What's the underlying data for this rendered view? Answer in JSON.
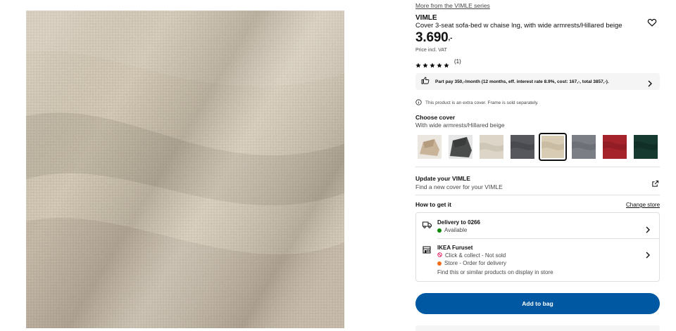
{
  "product": {
    "series_link": "More from the VIMLE series",
    "brand": "VIMLE",
    "description": "Cover 3-seat sofa-bed w chaise lng, with wide armrests/Hillared beige",
    "price_main": "3.690",
    "price_decimal": ",-",
    "vat_note": "Price incl. VAT",
    "rating_count": "(1)",
    "rating_value": 5,
    "favourite_icon": "heart-outline-icon",
    "image_alt": "Hillared beige fabric"
  },
  "finance": {
    "text": "Part pay 350,-/month (12 months, eff. interest rate 8.9%, cost: 167,-, total 3857,-).",
    "icon": "thumbs-up-icon"
  },
  "info": {
    "text": "This product is an extra cover. Frame is sold separately.",
    "icon": "info-icon"
  },
  "cover": {
    "title": "Choose cover",
    "selected": "With wide armrests/Hillared beige",
    "swatches": [
      {
        "name": "beige-natural",
        "color": "#c9b49a"
      },
      {
        "name": "dark-grey",
        "color": "#4a4c4c"
      },
      {
        "name": "light-beige",
        "color": "#ddd6c8"
      },
      {
        "name": "anthracite",
        "color": "#55575c"
      },
      {
        "name": "hillared-beige",
        "color": "#d8ccb4",
        "selected": true
      },
      {
        "name": "grey",
        "color": "#7b7e84"
      },
      {
        "name": "dark-red",
        "color": "#a5232b"
      },
      {
        "name": "dark-green",
        "color": "#163a30"
      }
    ]
  },
  "update": {
    "title": "Update your VIMLE",
    "subtitle": "Find a new cover for your VIMLE",
    "icon": "external-link-icon"
  },
  "delivery": {
    "heading": "How to get it",
    "change_store": "Change store",
    "delivery_title": "Delivery to 0266",
    "delivery_status": "Available",
    "delivery_status_color": "#0a8a00",
    "store_title": "IKEA Furuset",
    "click_collect": "Click & collect - Not sold",
    "click_collect_color": "#e00751",
    "store_order": "Store - Order for delivery",
    "store_order_color": "#f26a1b",
    "store_display": "Find this or similar products on display in store"
  },
  "actions": {
    "add_to_bag": "Add to bag"
  },
  "colors": {
    "accent": "#0058a3"
  }
}
